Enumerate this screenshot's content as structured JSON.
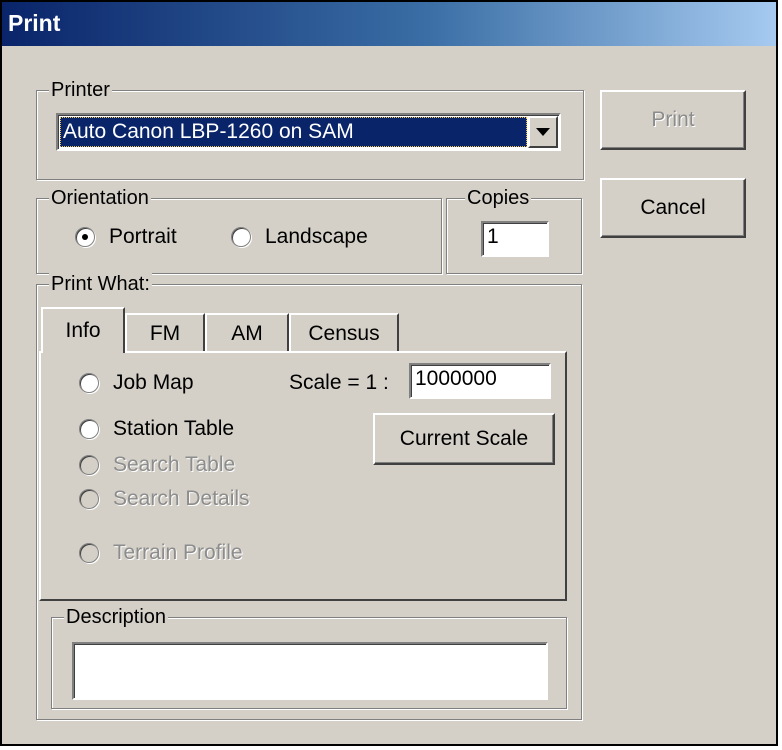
{
  "window": {
    "title": "Print"
  },
  "printer": {
    "legend": "Printer",
    "selected": "Auto Canon LBP-1260 on SAM"
  },
  "buttons": {
    "print": "Print",
    "cancel": "Cancel",
    "current_scale": "Current Scale"
  },
  "orientation": {
    "legend": "Orientation",
    "portrait": "Portrait",
    "landscape": "Landscape",
    "selected": "Portrait"
  },
  "copies": {
    "legend": "Copies",
    "value": "1"
  },
  "print_what": {
    "legend": "Print What:",
    "tabs": [
      "Info",
      "FM",
      "AM",
      "Census"
    ],
    "active_tab": "Info",
    "options": {
      "job_map": "Job Map",
      "station_table": "Station Table",
      "search_table": "Search Table",
      "search_details": "Search Details",
      "terrain_profile": "Terrain Profile"
    },
    "scale_label": "Scale = 1 :",
    "scale_value": "1000000"
  },
  "description": {
    "legend": "Description",
    "value": ""
  }
}
